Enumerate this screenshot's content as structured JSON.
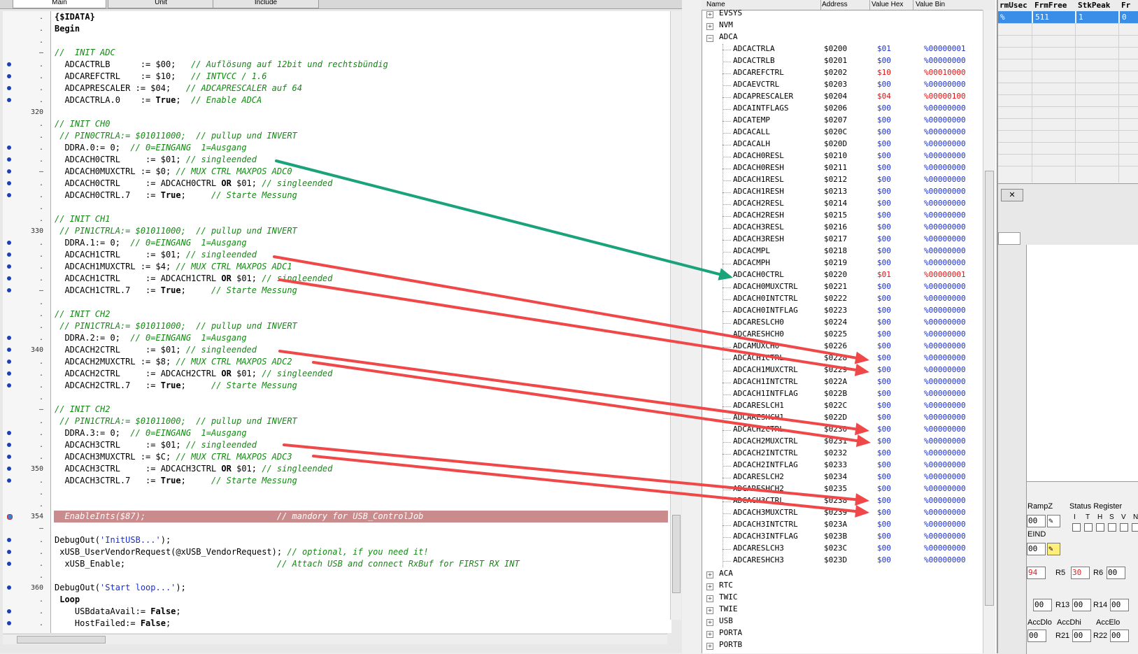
{
  "tabs": [
    "Main",
    "Unit",
    "Include"
  ],
  "io_headers": {
    "name": "Name",
    "address": "Address",
    "hex": "Value Hex",
    "bin": "Value Bin"
  },
  "gutter": [
    {
      "n": ".",
      "bp": false
    },
    {
      "n": ".",
      "bp": false
    },
    {
      "n": ".",
      "bp": false
    },
    {
      "n": "–",
      "bp": false
    },
    {
      "n": ".",
      "bp": true
    },
    {
      "n": ".",
      "bp": true
    },
    {
      "n": ".",
      "bp": true
    },
    {
      "n": ".",
      "bp": true
    },
    {
      "n": "320",
      "bp": false
    },
    {
      "n": ".",
      "bp": false
    },
    {
      "n": ".",
      "bp": false
    },
    {
      "n": ".",
      "bp": true
    },
    {
      "n": ".",
      "bp": true
    },
    {
      "n": "–",
      "bp": true
    },
    {
      "n": ".",
      "bp": true
    },
    {
      "n": ".",
      "bp": true
    },
    {
      "n": ".",
      "bp": false
    },
    {
      "n": ".",
      "bp": false
    },
    {
      "n": "330",
      "bp": false
    },
    {
      "n": ".",
      "bp": true
    },
    {
      "n": ".",
      "bp": true
    },
    {
      "n": ".",
      "bp": true
    },
    {
      "n": ".",
      "bp": true
    },
    {
      "n": "–",
      "bp": true
    },
    {
      "n": ".",
      "bp": false
    },
    {
      "n": ".",
      "bp": false
    },
    {
      "n": ".",
      "bp": false
    },
    {
      "n": ".",
      "bp": true
    },
    {
      "n": "340",
      "bp": true
    },
    {
      "n": ".",
      "bp": true
    },
    {
      "n": ".",
      "bp": true
    },
    {
      "n": ".",
      "bp": true
    },
    {
      "n": ".",
      "bp": false
    },
    {
      "n": "–",
      "bp": false
    },
    {
      "n": ".",
      "bp": false
    },
    {
      "n": ".",
      "bp": true
    },
    {
      "n": ".",
      "bp": true
    },
    {
      "n": ".",
      "bp": true
    },
    {
      "n": "350",
      "bp": true
    },
    {
      "n": ".",
      "bp": true
    },
    {
      "n": ".",
      "bp": false
    },
    {
      "n": ".",
      "bp": false
    },
    {
      "n": "354",
      "bp": true
    },
    {
      "n": "–",
      "bp": false
    },
    {
      "n": ".",
      "bp": true
    },
    {
      "n": ".",
      "bp": true
    },
    {
      "n": ".",
      "bp": true
    },
    {
      "n": ".",
      "bp": false
    },
    {
      "n": "360",
      "bp": true
    },
    {
      "n": ".",
      "bp": false
    },
    {
      "n": ".",
      "bp": true
    },
    {
      "n": ".",
      "bp": true
    }
  ],
  "code": [
    [
      [
        "k",
        "{$IDATA}"
      ]
    ],
    [
      [
        "k",
        "Begin"
      ]
    ],
    [],
    [
      [
        "c",
        "//  INIT ADC"
      ]
    ],
    [
      [
        "",
        "  ADCACTRLB      := $00;   "
      ],
      [
        "c",
        "// Auflösung auf 12bit und rechtsbündig"
      ]
    ],
    [
      [
        "",
        "  ADCAREFCTRL    := $10;   "
      ],
      [
        "c",
        "// INTVCC / 1.6"
      ]
    ],
    [
      [
        "",
        "  ADCAPRESCALER := $04;   "
      ],
      [
        "c",
        "// ADCAPRESCALER auf 64"
      ]
    ],
    [
      [
        "",
        "  ADCACTRLA.0    := "
      ],
      [
        "k",
        "True"
      ],
      [
        "",
        ";  "
      ],
      [
        "c",
        "// Enable ADCA"
      ]
    ],
    [],
    [
      [
        "c",
        "// INIT CH0"
      ]
    ],
    [
      [
        "c",
        " // PIN0CTRLA:= $01011000;  // pullup und INVERT"
      ]
    ],
    [
      [
        "",
        "  DDRA.0:= 0;  "
      ],
      [
        "c",
        "// 0=EINGANG  1=Ausgang"
      ]
    ],
    [
      [
        "",
        "  ADCACH0CTRL     := $01; "
      ],
      [
        "c",
        "// singleended"
      ]
    ],
    [
      [
        "",
        "  ADCACH0MUXCTRL := $0; "
      ],
      [
        "c",
        "// MUX CTRL MAXPOS ADC0"
      ]
    ],
    [
      [
        "",
        "  ADCACH0CTRL     := ADCACH0CTRL "
      ],
      [
        "k",
        "OR"
      ],
      [
        "",
        " $01; "
      ],
      [
        "c",
        "// singleended"
      ]
    ],
    [
      [
        "",
        "  ADCACH0CTRL.7   := "
      ],
      [
        "k",
        "True"
      ],
      [
        "",
        ";     "
      ],
      [
        "c",
        "// Starte Messung"
      ]
    ],
    [],
    [
      [
        "c",
        "// INIT CH1"
      ]
    ],
    [
      [
        "c",
        " // PIN1CTRLA:= $01011000;  // pullup und INVERT"
      ]
    ],
    [
      [
        "",
        "  DDRA.1:= 0;  "
      ],
      [
        "c",
        "// 0=EINGANG  1=Ausgang"
      ]
    ],
    [
      [
        "",
        "  ADCACH1CTRL     := $01; "
      ],
      [
        "c",
        "// singleended"
      ]
    ],
    [
      [
        "",
        "  ADCACH1MUXCTRL := $4; "
      ],
      [
        "c",
        "// MUX CTRL MAXPOS ADC1"
      ]
    ],
    [
      [
        "",
        "  ADCACH1CTRL     := ADCACH1CTRL "
      ],
      [
        "k",
        "OR"
      ],
      [
        "",
        " $01; "
      ],
      [
        "c",
        "// singleended"
      ]
    ],
    [
      [
        "",
        "  ADCACH1CTRL.7   := "
      ],
      [
        "k",
        "True"
      ],
      [
        "",
        ";     "
      ],
      [
        "c",
        "// Starte Messung"
      ]
    ],
    [],
    [
      [
        "c",
        "// INIT CH2"
      ]
    ],
    [
      [
        "c",
        " // PIN1CTRLA:= $01011000;  // pullup und INVERT"
      ]
    ],
    [
      [
        "",
        "  DDRA.2:= 0;  "
      ],
      [
        "c",
        "// 0=EINGANG  1=Ausgang"
      ]
    ],
    [
      [
        "",
        "  ADCACH2CTRL     := $01; "
      ],
      [
        "c",
        "// singleended"
      ]
    ],
    [
      [
        "",
        "  ADCACH2MUXCTRL := $8; "
      ],
      [
        "c",
        "// MUX CTRL MAXPOS ADC2"
      ]
    ],
    [
      [
        "",
        "  ADCACH2CTRL     := ADCACH2CTRL "
      ],
      [
        "k",
        "OR"
      ],
      [
        "",
        " $01; "
      ],
      [
        "c",
        "// singleended"
      ]
    ],
    [
      [
        "",
        "  ADCACH2CTRL.7   := "
      ],
      [
        "k",
        "True"
      ],
      [
        "",
        ";     "
      ],
      [
        "c",
        "// Starte Messung"
      ]
    ],
    [],
    [
      [
        "c",
        "// INIT CH2"
      ]
    ],
    [
      [
        "c",
        " // PIN1CTRLA:= $01011000;  // pullup und INVERT"
      ]
    ],
    [
      [
        "",
        "  DDRA.3:= 0;  "
      ],
      [
        "c",
        "// 0=EINGANG  1=Ausgang"
      ]
    ],
    [
      [
        "",
        "  ADCACH3CTRL     := $01; "
      ],
      [
        "c",
        "// singleended"
      ]
    ],
    [
      [
        "",
        "  ADCACH3MUXCTRL := $C; "
      ],
      [
        "c",
        "// MUX CTRL MAXPOS ADC3"
      ]
    ],
    [
      [
        "",
        "  ADCACH3CTRL     := ADCACH3CTRL "
      ],
      [
        "k",
        "OR"
      ],
      [
        "",
        " $01; "
      ],
      [
        "c",
        "// singleended"
      ]
    ],
    [
      [
        "",
        "  ADCACH3CTRL.7   := "
      ],
      [
        "k",
        "True"
      ],
      [
        "",
        ";     "
      ],
      [
        "c",
        "// Starte Messung"
      ]
    ],
    [],
    [],
    [
      [
        "h",
        "  EnableInts($87);                          // mandory for USB_ControlJob"
      ]
    ],
    [],
    [
      [
        "",
        "DebugOut("
      ],
      [
        "s",
        "'InitUSB...'"
      ],
      [
        "",
        ");"
      ]
    ],
    [
      [
        "",
        "",
        " xUSB_UserVendorRequest(@xUSB_VendorRequest); "
      ],
      [
        "c",
        "// optional, if you need it!"
      ]
    ],
    [
      [
        "",
        "  xUSB_Enable;                              "
      ],
      [
        "c",
        "// Attach USB and connect RxBuf for FIRST RX INT"
      ]
    ],
    [],
    [
      [
        "",
        "DebugOut("
      ],
      [
        "s",
        "'Start loop...'"
      ],
      [
        "",
        ");"
      ]
    ],
    [
      [
        "",
        "",
        " "
      ],
      [
        "k",
        "Loop"
      ]
    ],
    [
      [
        "",
        "    USBdataAvail:= "
      ],
      [
        "k",
        "False"
      ],
      [
        ";",
        ""
      ]
    ],
    [
      [
        "",
        "    HostFailed:= "
      ],
      [
        "k",
        "False"
      ],
      [
        ";",
        ""
      ]
    ]
  ],
  "tree_top": [
    "EVSYS",
    "NVM",
    "ADCA"
  ],
  "tree_bottom": [
    "ACA",
    "RTC",
    "TWIC",
    "TWIE",
    "USB",
    "PORTA",
    "PORTB"
  ],
  "registers": [
    [
      "ADCACTRLA",
      "$0200",
      "$01",
      "%00000001",
      false
    ],
    [
      "ADCACTRLB",
      "$0201",
      "$00",
      "%00000000",
      false
    ],
    [
      "ADCAREFCTRL",
      "$0202",
      "$10",
      "%00010000",
      true
    ],
    [
      "ADCAEVCTRL",
      "$0203",
      "$00",
      "%00000000",
      false
    ],
    [
      "ADCAPRESCALER",
      "$0204",
      "$04",
      "%00000100",
      true
    ],
    [
      "ADCAINTFLAGS",
      "$0206",
      "$00",
      "%00000000",
      false
    ],
    [
      "ADCATEMP",
      "$0207",
      "$00",
      "%00000000",
      false
    ],
    [
      "ADCACALL",
      "$020C",
      "$00",
      "%00000000",
      false
    ],
    [
      "ADCACALH",
      "$020D",
      "$00",
      "%00000000",
      false
    ],
    [
      "ADCACH0RESL",
      "$0210",
      "$00",
      "%00000000",
      false
    ],
    [
      "ADCACH0RESH",
      "$0211",
      "$00",
      "%00000000",
      false
    ],
    [
      "ADCACH1RESL",
      "$0212",
      "$00",
      "%00000000",
      false
    ],
    [
      "ADCACH1RESH",
      "$0213",
      "$00",
      "%00000000",
      false
    ],
    [
      "ADCACH2RESL",
      "$0214",
      "$00",
      "%00000000",
      false
    ],
    [
      "ADCACH2RESH",
      "$0215",
      "$00",
      "%00000000",
      false
    ],
    [
      "ADCACH3RESL",
      "$0216",
      "$00",
      "%00000000",
      false
    ],
    [
      "ADCACH3RESH",
      "$0217",
      "$00",
      "%00000000",
      false
    ],
    [
      "ADCACMPL",
      "$0218",
      "$00",
      "%00000000",
      false
    ],
    [
      "ADCACMPH",
      "$0219",
      "$00",
      "%00000000",
      false
    ],
    [
      "ADCACH0CTRL",
      "$0220",
      "$01",
      "%00000001",
      true
    ],
    [
      "ADCACH0MUXCTRL",
      "$0221",
      "$00",
      "%00000000",
      false
    ],
    [
      "ADCACH0INTCTRL",
      "$0222",
      "$00",
      "%00000000",
      false
    ],
    [
      "ADCACH0INTFLAG",
      "$0223",
      "$00",
      "%00000000",
      false
    ],
    [
      "ADCARESLCH0",
      "$0224",
      "$00",
      "%00000000",
      false
    ],
    [
      "ADCARESHCH0",
      "$0225",
      "$00",
      "%00000000",
      false
    ],
    [
      "ADCAMUXCH0",
      "$0226",
      "$00",
      "%00000000",
      false
    ],
    [
      "ADCACH1CTRL",
      "$0228",
      "$00",
      "%00000000",
      false
    ],
    [
      "ADCACH1MUXCTRL",
      "$0229",
      "$00",
      "%00000000",
      false
    ],
    [
      "ADCACH1INTCTRL",
      "$022A",
      "$00",
      "%00000000",
      false
    ],
    [
      "ADCACH1INTFLAG",
      "$022B",
      "$00",
      "%00000000",
      false
    ],
    [
      "ADCARESLCH1",
      "$022C",
      "$00",
      "%00000000",
      false
    ],
    [
      "ADCARESHCH1",
      "$022D",
      "$00",
      "%00000000",
      false
    ],
    [
      "ADCACH2CTRL",
      "$0230",
      "$00",
      "%00000000",
      false
    ],
    [
      "ADCACH2MUXCTRL",
      "$0231",
      "$00",
      "%00000000",
      false
    ],
    [
      "ADCACH2INTCTRL",
      "$0232",
      "$00",
      "%00000000",
      false
    ],
    [
      "ADCACH2INTFLAG",
      "$0233",
      "$00",
      "%00000000",
      false
    ],
    [
      "ADCARESLCH2",
      "$0234",
      "$00",
      "%00000000",
      false
    ],
    [
      "ADCARESHCH2",
      "$0235",
      "$00",
      "%00000000",
      false
    ],
    [
      "ADCACH3CTRL",
      "$0238",
      "$00",
      "%00000000",
      false
    ],
    [
      "ADCACH3MUXCTRL",
      "$0239",
      "$00",
      "%00000000",
      false
    ],
    [
      "ADCACH3INTCTRL",
      "$023A",
      "$00",
      "%00000000",
      false
    ],
    [
      "ADCACH3INTFLAG",
      "$023B",
      "$00",
      "%00000000",
      false
    ],
    [
      "ADCARESLCH3",
      "$023C",
      "$00",
      "%00000000",
      false
    ],
    [
      "ADCARESHCH3",
      "$023D",
      "$00",
      "%00000000",
      false
    ]
  ],
  "frame_headers": [
    "rmUsec",
    "FrmFree",
    "StkPeak",
    "Fr"
  ],
  "frame_values": [
    "%",
    "511",
    "1",
    "0"
  ],
  "cpu": {
    "rampz": "RampZ",
    "rampz_val": "00",
    "eind": "EIND",
    "eind_val": "00",
    "status": "Status Register",
    "flags": [
      "I",
      "T",
      "H",
      "S",
      "V",
      "N"
    ],
    "r4_val": "94",
    "r5": "R5",
    "r5_val": "30",
    "r6": "R6",
    "r6_val": "00",
    "r12_val": "00",
    "r13": "R13",
    "r13_val": "00",
    "r14": "R14",
    "r14_val": "00",
    "accdlo": "AccDlo",
    "accdhi": "AccDhi",
    "accelo": "AccElo",
    "r20_val": "00",
    "r21": "R21",
    "r21_val": "00",
    "r22": "R22",
    "r22_val": "00"
  },
  "arrow_colors": {
    "green": "#1aa37a",
    "red": "#f04848"
  }
}
